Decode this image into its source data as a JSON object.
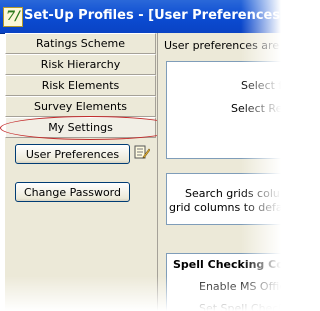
{
  "window": {
    "title": "Set-Up Profiles - [User Preferences]",
    "icon_letters": "7/"
  },
  "nav": {
    "items": [
      {
        "label": "Ratings Scheme"
      },
      {
        "label": "Risk Hierarchy"
      },
      {
        "label": "Risk Elements"
      },
      {
        "label": "Survey Elements"
      },
      {
        "label": "My Settings",
        "selected": true
      }
    ]
  },
  "settings": {
    "user_preferences_label": "User Preferences",
    "change_password_label": "Change Password"
  },
  "right_panel": {
    "intro": "User preferences are a",
    "select_1": "Select f",
    "select_2": "Select Re",
    "search_line_1": "Search grids colum",
    "search_line_2": "grid columns to default",
    "spell_heading": "Spell Checking Co",
    "spell_line_1": "Enable MS Offic",
    "spell_line_2": "Set Spell Check"
  },
  "colors": {
    "title_bar": "#0b4bd1",
    "highlight_ellipse": "#c42b2b",
    "panel_bg": "#ece9d8"
  }
}
